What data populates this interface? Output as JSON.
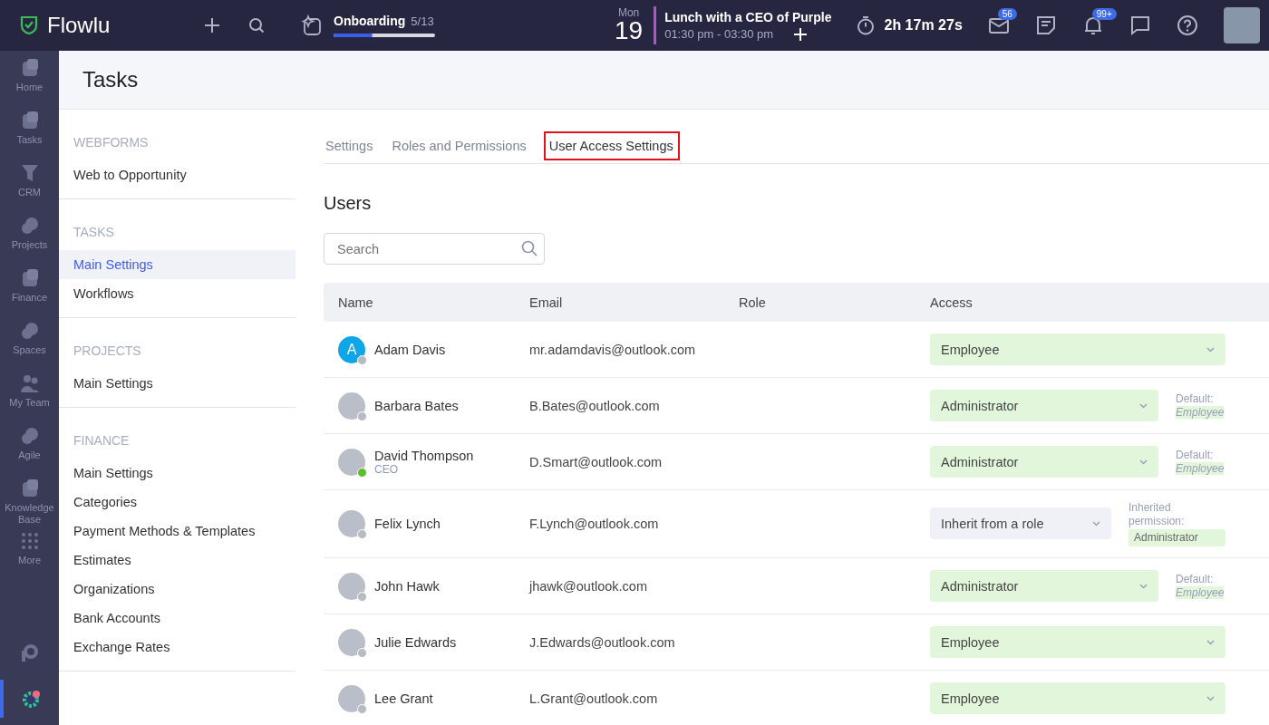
{
  "topbar": {
    "logo": "Flowlu",
    "onboarding": {
      "title": "Onboarding",
      "count": "5/13",
      "level": 0.38
    },
    "event": {
      "weekday": "Mon",
      "day": "19",
      "title": "Lunch with a CEO of Purple",
      "time": "01:30 pm - 03:30 pm"
    },
    "timer": "2h 17m 27s",
    "mail_badge": "56",
    "bell_badge": "99+"
  },
  "rail": {
    "items": [
      {
        "label": "Home",
        "kind": "module"
      },
      {
        "label": "Tasks",
        "kind": "module"
      },
      {
        "label": "CRM",
        "kind": "funnel"
      },
      {
        "label": "Projects",
        "kind": "circles"
      },
      {
        "label": "Finance",
        "kind": "module"
      },
      {
        "label": "Spaces",
        "kind": "circles"
      },
      {
        "label": "My Team",
        "kind": "team"
      },
      {
        "label": "Agile",
        "kind": "circles"
      },
      {
        "label": "Knowledge Base",
        "kind": "module"
      },
      {
        "label": "More",
        "kind": "grid"
      }
    ],
    "bottom": [
      {
        "kind": "brand",
        "selected": false
      },
      {
        "kind": "settings",
        "selected": true
      }
    ]
  },
  "page_title": "Tasks",
  "settings_nav": [
    {
      "group": "WEBFORMS",
      "items": [
        {
          "label": "Web to Opportunity",
          "selected": false
        }
      ]
    },
    {
      "group": "TASKS",
      "items": [
        {
          "label": "Main Settings",
          "selected": true
        },
        {
          "label": "Workflows",
          "selected": false
        }
      ]
    },
    {
      "group": "PROJECTS",
      "items": [
        {
          "label": "Main Settings",
          "selected": false
        }
      ]
    },
    {
      "group": "FINANCE",
      "items": [
        {
          "label": "Main Settings",
          "selected": false
        },
        {
          "label": "Categories",
          "selected": false
        },
        {
          "label": "Payment Methods & Templates",
          "selected": false
        },
        {
          "label": "Estimates",
          "selected": false
        },
        {
          "label": "Organizations",
          "selected": false
        },
        {
          "label": "Bank Accounts",
          "selected": false
        },
        {
          "label": "Exchange Rates",
          "selected": false
        }
      ]
    }
  ],
  "tabs": [
    {
      "label": "Settings",
      "selected": false
    },
    {
      "label": "Roles and Permissions",
      "selected": false
    },
    {
      "label": "User Access Settings",
      "selected": true
    }
  ],
  "section_title": "Users",
  "search": {
    "placeholder": "Search"
  },
  "table": {
    "columns": [
      "Name",
      "Email",
      "Role",
      "Access"
    ],
    "rows": [
      {
        "name": "Adam Davis",
        "initial": "A",
        "online": false,
        "email": "mr.adamdavis@outlook.com",
        "access": {
          "value": "Employee",
          "kind": "custom"
        }
      },
      {
        "name": "Barbara Bates",
        "online": false,
        "email": "B.Bates@outlook.com",
        "access": {
          "value": "Administrator",
          "kind": "custom"
        },
        "note": {
          "kind": "default",
          "label": "Default:",
          "value": "Employee"
        }
      },
      {
        "name": "David Thompson",
        "subtitle": "CEO",
        "online": true,
        "email": "D.Smart@outlook.com",
        "access": {
          "value": "Administrator",
          "kind": "custom"
        },
        "note": {
          "kind": "default",
          "label": "Default:",
          "value": "Employee"
        }
      },
      {
        "name": "Felix Lynch",
        "online": false,
        "email": "F.Lynch@outlook.com",
        "access": {
          "value": "Inherit from a role",
          "kind": "inherit"
        },
        "note": {
          "kind": "inherited",
          "label": "Inherited permission:",
          "value": "Administrator"
        }
      },
      {
        "name": "John Hawk",
        "online": false,
        "email": "jhawk@outlook.com",
        "access": {
          "value": "Administrator",
          "kind": "custom"
        },
        "note": {
          "kind": "default",
          "label": "Default:",
          "value": "Employee"
        }
      },
      {
        "name": "Julie Edwards",
        "online": false,
        "email": "J.Edwards@outlook.com",
        "access": {
          "value": "Employee",
          "kind": "custom"
        }
      },
      {
        "name": "Lee Grant",
        "online": false,
        "email": "L.Grant@outlook.com",
        "access": {
          "value": "Employee",
          "kind": "custom"
        }
      }
    ]
  }
}
